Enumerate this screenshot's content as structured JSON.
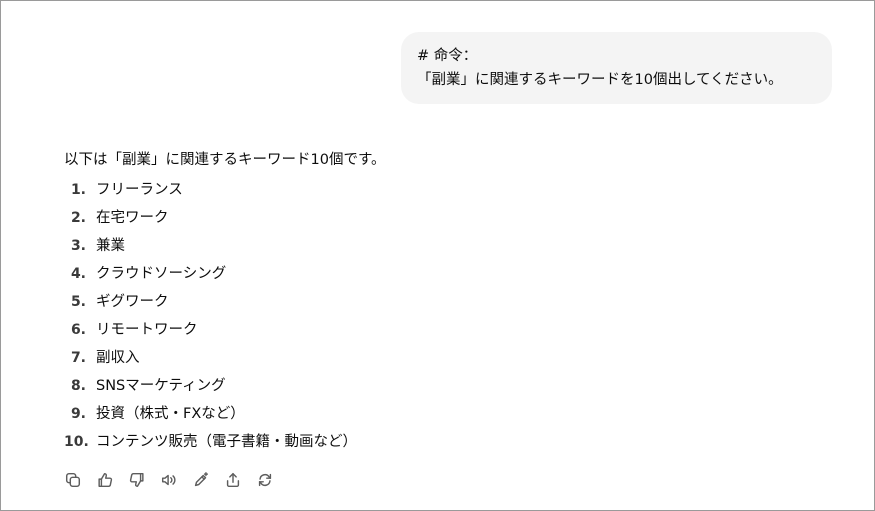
{
  "user_message": {
    "line1": "# 命令：",
    "line2": "「副業」に関連するキーワードを10個出してください。"
  },
  "assistant_message": {
    "intro": "以下は「副業」に関連するキーワード10個です。",
    "items": [
      {
        "num": "1.",
        "text": "フリーランス"
      },
      {
        "num": "2.",
        "text": "在宅ワーク"
      },
      {
        "num": "3.",
        "text": "兼業"
      },
      {
        "num": "4.",
        "text": "クラウドソーシング"
      },
      {
        "num": "5.",
        "text": "ギグワーク"
      },
      {
        "num": "6.",
        "text": "リモートワーク"
      },
      {
        "num": "7.",
        "text": "副収入"
      },
      {
        "num": "8.",
        "text": "SNSマーケティング"
      },
      {
        "num": "9.",
        "text": "投資（株式・FXなど）"
      },
      {
        "num": "10.",
        "text": "コンテンツ販売（電子書籍・動画など）"
      }
    ]
  },
  "action_icons": [
    "copy-icon",
    "thumbs-up-icon",
    "thumbs-down-icon",
    "read-aloud-icon",
    "edit-sparkle-icon",
    "share-icon",
    "regenerate-icon"
  ],
  "colors": {
    "user_bubble_bg": "#f4f4f4",
    "text": "#0d0d0d",
    "icon": "#5d5d5d",
    "frame_border": "#9a9a9a"
  }
}
